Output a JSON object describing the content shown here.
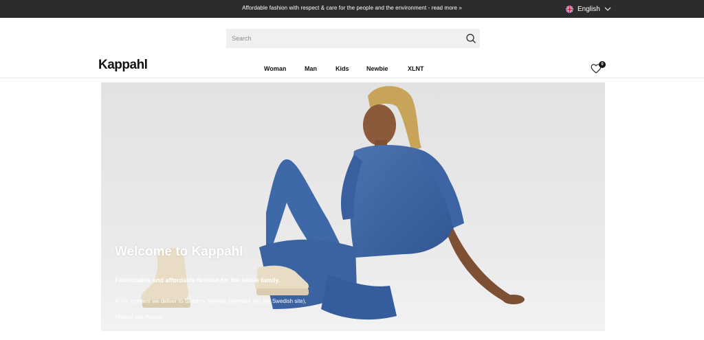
{
  "topbar": {
    "message": "Affordable fashion with respect & care for the people and the environment - read more »",
    "language": "English",
    "language_flag_icon": "uk-flag-icon",
    "language_chevron_icon": "chevron-down-icon"
  },
  "search": {
    "placeholder": "Search",
    "icon": "search-icon"
  },
  "header": {
    "logo": "Kappahl",
    "nav": [
      "Woman",
      "Man",
      "Kids",
      "Newbie",
      "XLNT"
    ],
    "wishlist_icon": "heart-icon",
    "wishlist_count": "0"
  },
  "hero": {
    "title": "Welcome to Kappahl",
    "subtitle": "Fashionable and affordable fashion for the whole family.",
    "text": "At the moment we deliver to Sweden, Norway, Denmark (via the Swedish site), Finland and Poland."
  },
  "colors": {
    "topbar_bg": "#2c2c2c",
    "search_bg": "#f0f0f0",
    "hero_bg": "#e9e9e9",
    "denim": "#3f64a3"
  }
}
